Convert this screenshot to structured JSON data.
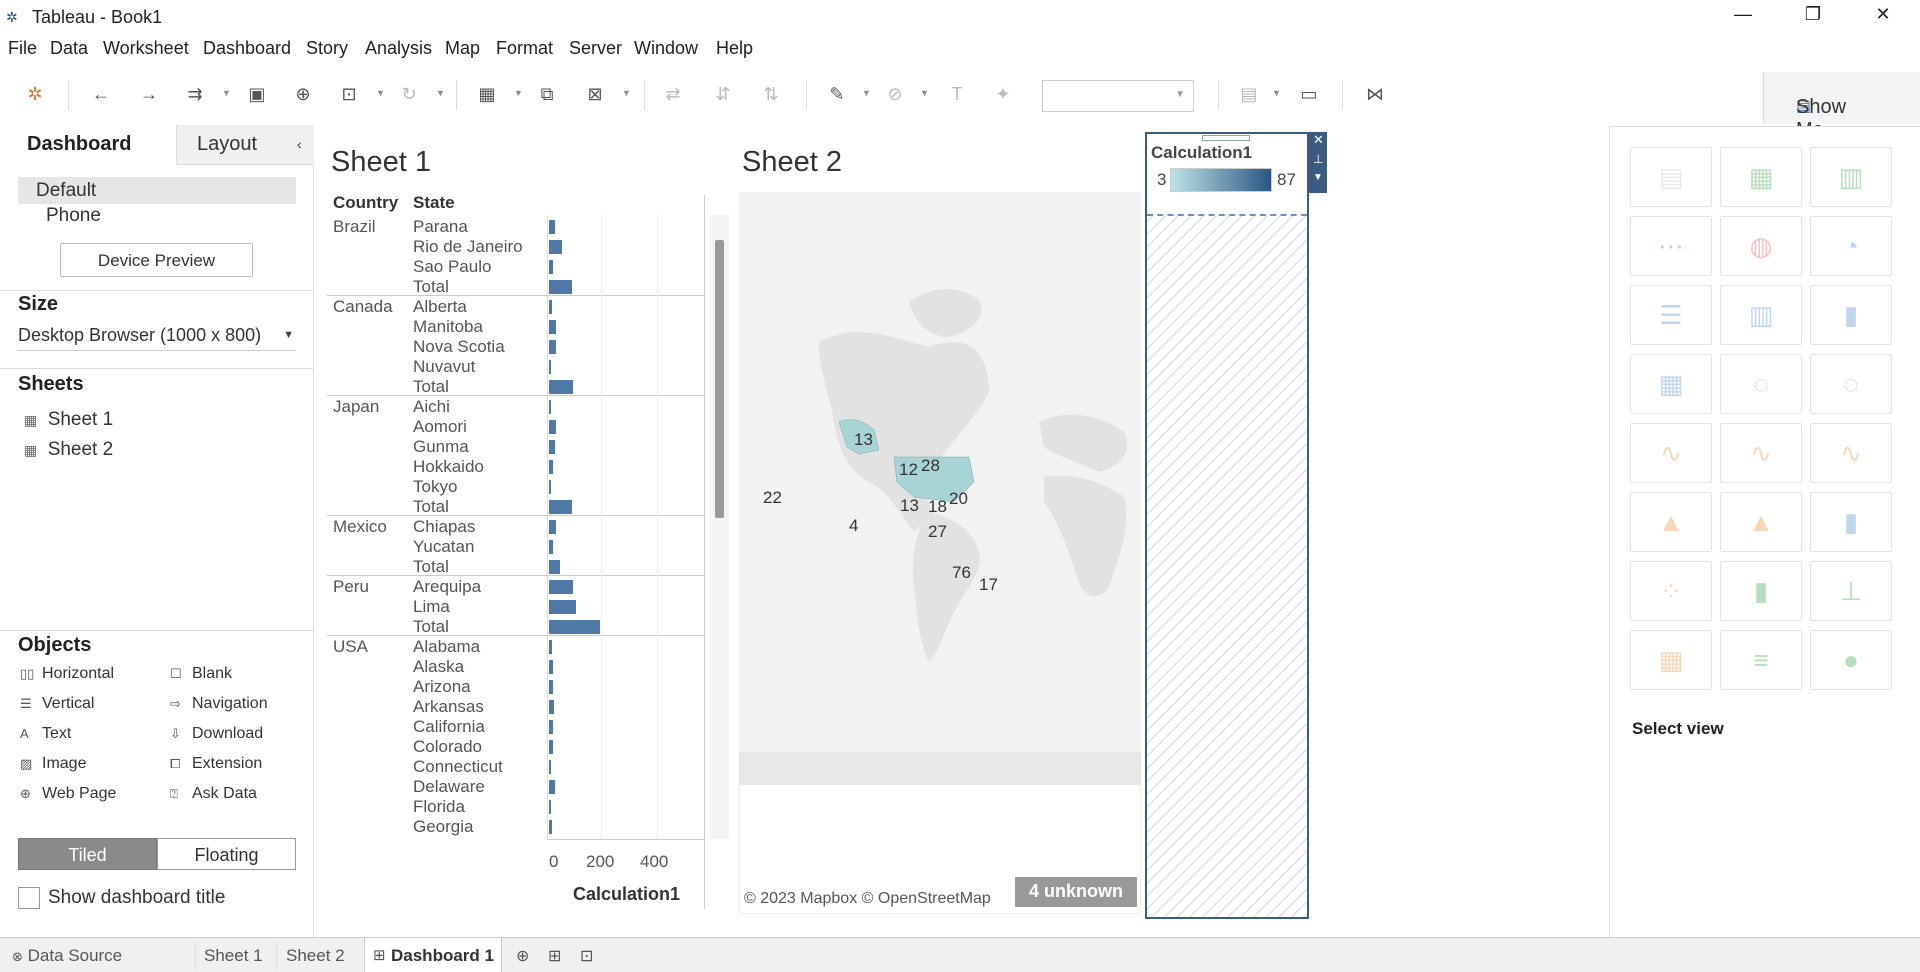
{
  "window": {
    "title": "Tableau - Book1"
  },
  "menu": [
    "File",
    "Data",
    "Worksheet",
    "Dashboard",
    "Story",
    "Analysis",
    "Map",
    "Format",
    "Server",
    "Window",
    "Help"
  ],
  "show_me": "Show Me",
  "left_panel": {
    "tabs": [
      "Dashboard",
      "Layout"
    ],
    "device_options": [
      "Default",
      "Phone"
    ],
    "device_preview": "Device Preview",
    "size_header": "Size",
    "size_value": "Desktop Browser (1000 x 800)",
    "sheets_header": "Sheets",
    "sheets": [
      "Sheet 1",
      "Sheet 2"
    ],
    "objects_header": "Objects",
    "objects": [
      {
        "label": "Horizontal",
        "icon": "horizontal-container-icon"
      },
      {
        "label": "Blank",
        "icon": "blank-icon"
      },
      {
        "label": "Vertical",
        "icon": "vertical-container-icon"
      },
      {
        "label": "Navigation",
        "icon": "navigation-icon"
      },
      {
        "label": "Text",
        "icon": "text-icon"
      },
      {
        "label": "Download",
        "icon": "download-icon"
      },
      {
        "label": "Image",
        "icon": "image-icon"
      },
      {
        "label": "Extension",
        "icon": "extension-icon"
      },
      {
        "label": "Web Page",
        "icon": "web-page-icon"
      },
      {
        "label": "Ask Data",
        "icon": "ask-data-icon"
      }
    ],
    "layout_modes": [
      "Tiled",
      "Floating"
    ],
    "show_title": "Show dashboard title"
  },
  "sheet1": {
    "title": "Sheet 1",
    "col_country": "Country",
    "col_state": "State",
    "groups": [
      {
        "country": "Brazil",
        "rows": [
          {
            "state": "Parana",
            "v": 20
          },
          {
            "state": "Rio de Janeiro",
            "v": 45
          },
          {
            "state": "Sao Paulo",
            "v": 15
          },
          {
            "state": "Total",
            "v": 80
          }
        ]
      },
      {
        "country": "Canada",
        "rows": [
          {
            "state": "Alberta",
            "v": 10
          },
          {
            "state": "Manitoba",
            "v": 25
          },
          {
            "state": "Nova Scotia",
            "v": 25
          },
          {
            "state": "Nuvavut",
            "v": 8
          },
          {
            "state": "Total",
            "v": 85
          }
        ]
      },
      {
        "country": "Japan",
        "rows": [
          {
            "state": "Aichi",
            "v": 5
          },
          {
            "state": "Aomori",
            "v": 25
          },
          {
            "state": "Gunma",
            "v": 20
          },
          {
            "state": "Hokkaido",
            "v": 15
          },
          {
            "state": "Tokyo",
            "v": 8
          },
          {
            "state": "Total",
            "v": 80
          }
        ]
      },
      {
        "country": "Mexico",
        "rows": [
          {
            "state": "Chiapas",
            "v": 25
          },
          {
            "state": "Yucatan",
            "v": 15
          },
          {
            "state": "Total",
            "v": 40
          }
        ]
      },
      {
        "country": "Peru",
        "rows": [
          {
            "state": "Arequipa",
            "v": 85
          },
          {
            "state": "Lima",
            "v": 95
          },
          {
            "state": "Total",
            "v": 180
          }
        ]
      },
      {
        "country": "USA",
        "rows": [
          {
            "state": "Alabama",
            "v": 12
          },
          {
            "state": "Alaska",
            "v": 13
          },
          {
            "state": "Arizona",
            "v": 15
          },
          {
            "state": "Arkansas",
            "v": 17
          },
          {
            "state": "California",
            "v": 14
          },
          {
            "state": "Colorado",
            "v": 15
          },
          {
            "state": "Connecticut",
            "v": 3
          },
          {
            "state": "Delaware",
            "v": 20
          },
          {
            "state": "Florida",
            "v": 6
          },
          {
            "state": "Georgia",
            "v": 10
          }
        ]
      }
    ],
    "axis_ticks": [
      "0",
      "200",
      "400"
    ],
    "axis_label": "Calculation1"
  },
  "sheet2": {
    "title": "Sheet 2",
    "labels": [
      "13",
      "12",
      "28",
      "22",
      "13",
      "18",
      "20",
      "4",
      "27",
      "76",
      "17"
    ],
    "attribution": "© 2023 Mapbox © OpenStreetMap",
    "unknown": "4 unknown"
  },
  "legend": {
    "title": "Calculation1",
    "min": "3",
    "max": "87"
  },
  "show_me_panel": {
    "select_view": "Select view"
  },
  "bottom_tabs": [
    "Data Source",
    "Sheet 1",
    "Sheet 2",
    "Dashboard 1"
  ],
  "colors": {
    "bar": "#4e79a7",
    "legend_start": "#bde3e6",
    "legend_end": "#2a5783",
    "tableau_blue": "#1f4e8c"
  }
}
